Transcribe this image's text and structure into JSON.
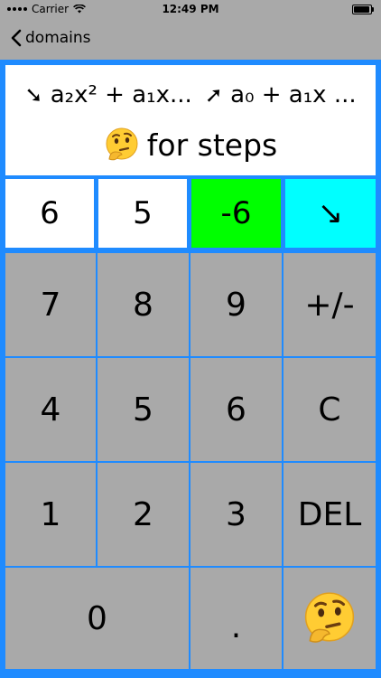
{
  "status": {
    "carrier": "Carrier",
    "time": "12:49 PM"
  },
  "nav": {
    "back_label": "domains"
  },
  "display": {
    "left_formula": "a₂x² + a₁x...",
    "right_formula": "a₀ + a₁x ...",
    "hint": "for steps"
  },
  "coefficients": [
    {
      "value": "6",
      "color": "#ffffff"
    },
    {
      "value": "5",
      "color": "#ffffff"
    },
    {
      "value": "-6",
      "color": "#00ff00"
    },
    {
      "value": "↘",
      "color": "#00ffff"
    }
  ],
  "keys": {
    "k7": "7",
    "k8": "8",
    "k9": "9",
    "plusminus": "+/-",
    "k4": "4",
    "k5": "5",
    "k6": "6",
    "clear": "C",
    "k1": "1",
    "k2": "2",
    "k3": "3",
    "del": "DEL",
    "k0": "0",
    "dot": "."
  },
  "colors": {
    "accent": "#1f8bff",
    "key_bg": "#a9a9a9"
  }
}
